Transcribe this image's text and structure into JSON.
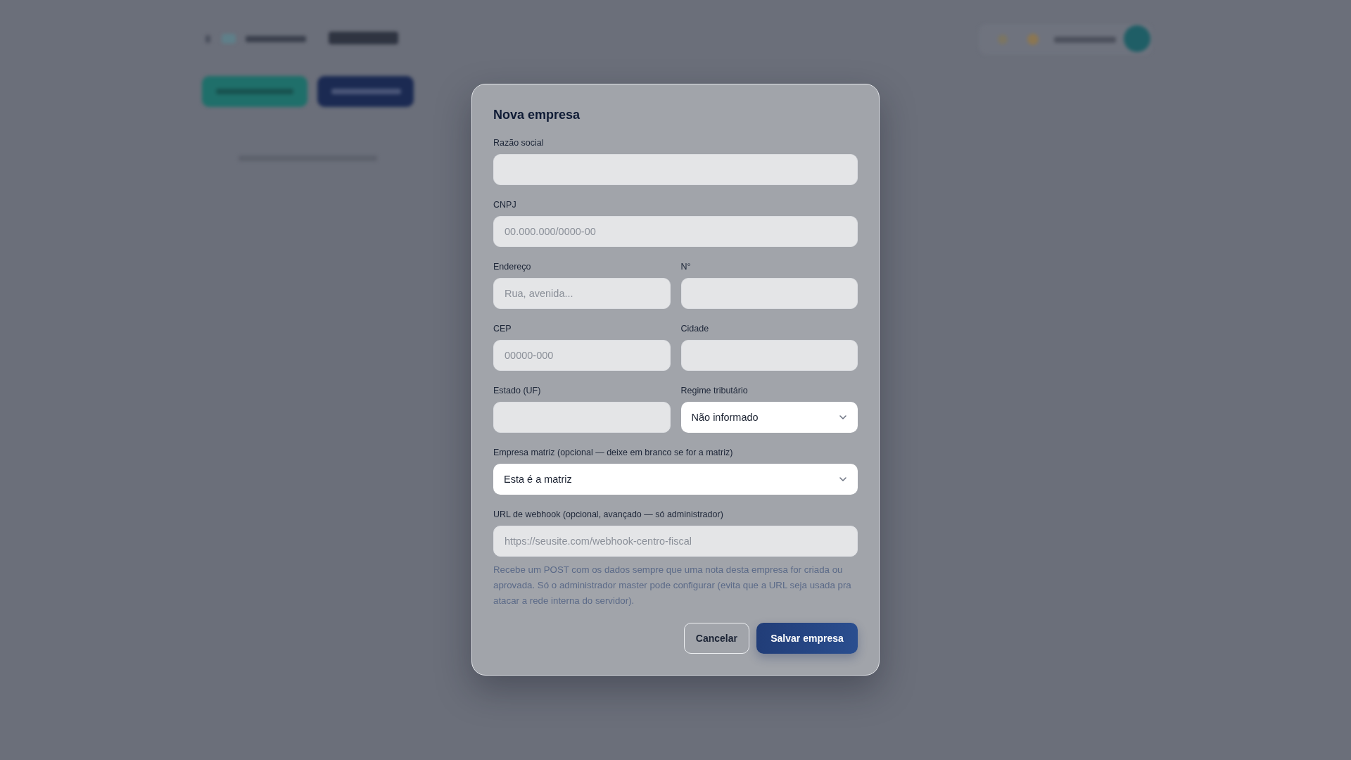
{
  "dialog": {
    "title": "Nova empresa",
    "rows": [
      [
        {
          "label": "Razão social",
          "kind": "text"
        }
      ],
      [
        {
          "label": "CNPJ",
          "kind": "text",
          "placeholder": "00.000.000/0000-00"
        }
      ],
      [
        {
          "label": "Endereço",
          "kind": "text",
          "placeholder": "Rua, avenida..."
        },
        {
          "label": "N°",
          "kind": "text"
        }
      ],
      [
        {
          "label": "CEP",
          "kind": "text",
          "placeholder": "00000-000"
        },
        {
          "label": "Cidade",
          "kind": "text"
        }
      ],
      [
        {
          "label": "Estado (UF)",
          "kind": "text"
        },
        {
          "label": "Regime tributário",
          "kind": "select",
          "value": "Não informado"
        }
      ],
      [
        {
          "label": "Empresa matriz (opcional — deixe em branco se for a matriz)",
          "kind": "select",
          "value": "Esta é a matriz"
        }
      ],
      [
        {
          "label": "URL de webhook (opcional, avançado — só administrador)",
          "kind": "text",
          "placeholder": "https://seusite.com/webhook-centro-fiscal",
          "help": "Recebe um POST com os dados sempre que uma nota desta empresa for criada ou aprovada. Só o administrador master pode configurar (evita que a URL seja usada pra atacar a rede interna do servidor)."
        }
      ]
    ],
    "buttons": [
      {
        "label": "Cancelar",
        "kind": "secondary"
      },
      {
        "label": "Salvar empresa",
        "kind": "primary"
      }
    ]
  }
}
